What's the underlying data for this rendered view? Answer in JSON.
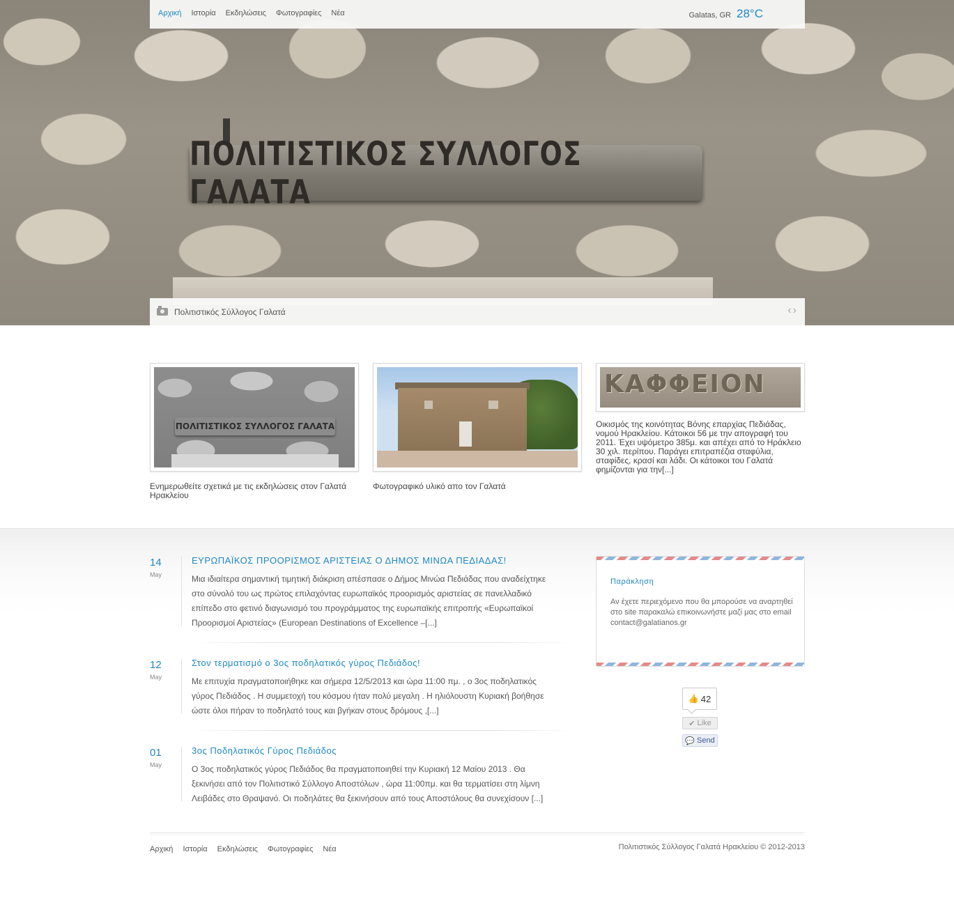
{
  "nav": {
    "items": [
      "Αρχική",
      "Ιστορία",
      "Εκδηλώσεις",
      "Φωτογραφίες",
      "Νέα"
    ],
    "active_index": 0
  },
  "weather": {
    "location": "Galatas, GR",
    "temperature": "28°C"
  },
  "hero": {
    "sign_text": "ΠΟΛΙΤΙΣΤΙΚΟΣ ΣΥΛΛΟΓΟΣ ΓΑΛΑΤΑ",
    "caption": "Πολιτιστικός Σύλλογος Γαλατά",
    "prev_arrow": "‹",
    "next_arrow": "›"
  },
  "features": [
    {
      "image_text": "ΠΟΛΙΤΙΣΤΙΚΟΣ ΣΥΛΛΟΓΟΣ ΓΑΛΑΤΑ",
      "text": "Ενημερωθείτε σχετικά με τις εκδηλώσεις στον Γαλατά Ηρακλείου"
    },
    {
      "text": "Φωτογραφικό υλικό απο τον Γαλατά"
    },
    {
      "image_text": "ΚΑΦΦΕΙΟΝ",
      "text": "Οικισμός της κοινότητας Βόνης επαρχίας Πεδιάδας, νομού Ηρακλείου. Κάτοικοι 56 με την απογραφή του 2011. Έχει υψόμετρο 385μ. και απέχει από το Ηράκλειο 30 χιλ. περίπου. Παράγει επιτραπέζια σταφύλια, σταφίδες, κρασί και λάδι. Οι κάτοικοι του Γαλατά φημίζονται για την[...]"
    }
  ],
  "posts": [
    {
      "day": "14",
      "month": "May",
      "title": "ΕΥΡΩΠΑΪΚΟΣ ΠΡΟΟΡΙΣΜΟΣ ΑΡΙΣΤΕΙΑΣ Ο ΔΗΜΟΣ ΜΙΝΩΑ ΠΕΔΙΑΔΑΣ!",
      "body": "Μια ιδιαίτερα σημαντική τιμητική διάκριση απέσπασε ο Δήμος Μινώα Πεδιάδας που αναδείχτηκε στο σύνολό του ως πρώτος επιλαχόντας ευρωπαϊκός προορισμός αριστείας σε πανελλαδικό επίπεδο στο φετινό διαγωνισμό του προγράμματος της ευρωπαϊκής επιτροπής «Ευρωπαϊκοί Προορισμοί Αριστείας» (European Destinations of Excellence –[...]"
    },
    {
      "day": "12",
      "month": "May",
      "title": "Στον τερματισμό ο 3ος ποδηλατικός γύρος Πεδιάδος!",
      "body": "Με επιτυχία πραγματοποιήθηκε και σήμερα 12/5/2013 και ώρα 11:00 πμ. , ο 3ος ποδηλατικός γύρος Πεδιάδος . Η συμμετοχή του κόσμου ήταν πολύ μεγαλη . Η ηλιόλουστη Κυριακή βοήθησε ώστε όλοι πήραν το ποδηλατό τους και βγήκαν στους δρόμους ,[...]"
    },
    {
      "day": "01",
      "month": "May",
      "title": "3ος Ποδηλατικός Γύρος Πεδιάδος",
      "body": "Ο 3ος ποδηλατικός γύρος Πεδιάδος θα πραγματοποιηθεί την Κυριακή 12 Μαίου 2013 . Θα ξεκινήσει από τον  Πολιτιστικό Σύλλογο Αποστόλων , ώρα 11:00πμ. και θα τερματίσει στη λίμνη Λειβάδες στο Θραψανό. Οι ποδηλάτες θα ξεκινήσουν από τους Αποστόλους θα συνεχίσουν [...]"
    }
  ],
  "sidebar": {
    "title": "Παράκληση",
    "text": "Αν έχετε περιεχόμενο που θα μπορούσε να αναρτηθεί στο site παρακαλώ επικοινωνήστε μαζί μας στο email contact@galatianos.gr"
  },
  "facebook": {
    "count": "42",
    "like_label": "Like",
    "send_label": "Send"
  },
  "footer": {
    "nav": [
      "Αρχική",
      "Ιστορία",
      "Εκδηλώσεις",
      "Φωτογραφίες",
      "Νέα"
    ],
    "copyright": "Πολιτιστικός Σύλλογος Γαλατά Ηρακλείου © 2012-2013"
  },
  "colors": {
    "accent": "#1e88c7",
    "facebook": "#3b5998"
  }
}
